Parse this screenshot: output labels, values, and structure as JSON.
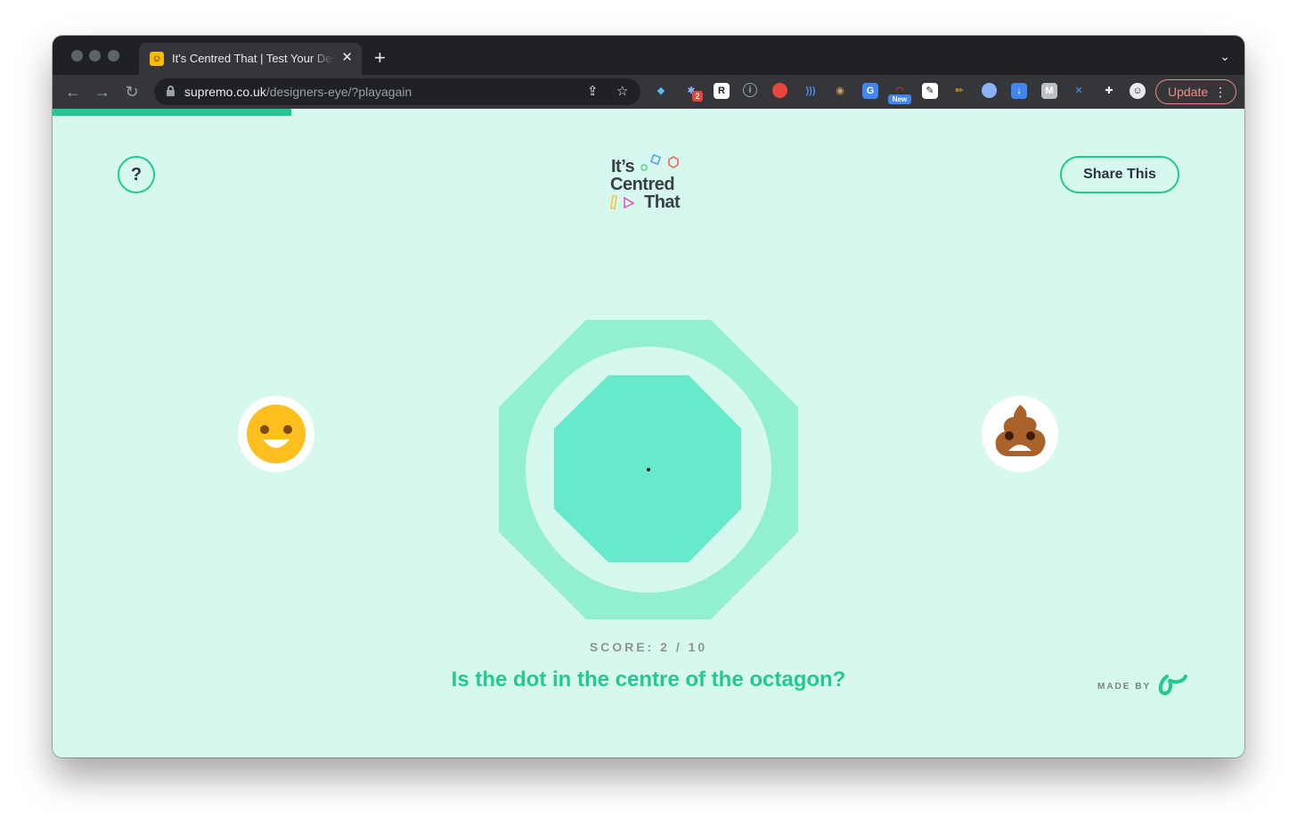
{
  "browser": {
    "tab_title": "It's Centred That | Test Your Designer's Eye",
    "url_host": "supremo.co.uk",
    "url_path": "/designers-eye/?playagain",
    "update_label": "Update",
    "extension_badge_count": "2",
    "extension_new_label": "New"
  },
  "game": {
    "logo_line1": "It’s",
    "logo_line2": "Centred",
    "logo_line3": "That",
    "help_label": "?",
    "share_label": "Share This",
    "score_text": "SCORE: 2 / 10",
    "question": "Is the dot in the centre of the octagon?",
    "made_by_label": "MADE BY",
    "progress_fraction": 0.2,
    "score": 2,
    "score_total": 10,
    "colors": {
      "accent": "#23c993",
      "background": "#d6f8ee",
      "outer_octagon": "#93efd1",
      "inner_octagon": "#66eacb",
      "ring": "#d6f8ee"
    },
    "yes_icon": "smiling-face-icon",
    "no_icon": "poop-frown-icon"
  }
}
